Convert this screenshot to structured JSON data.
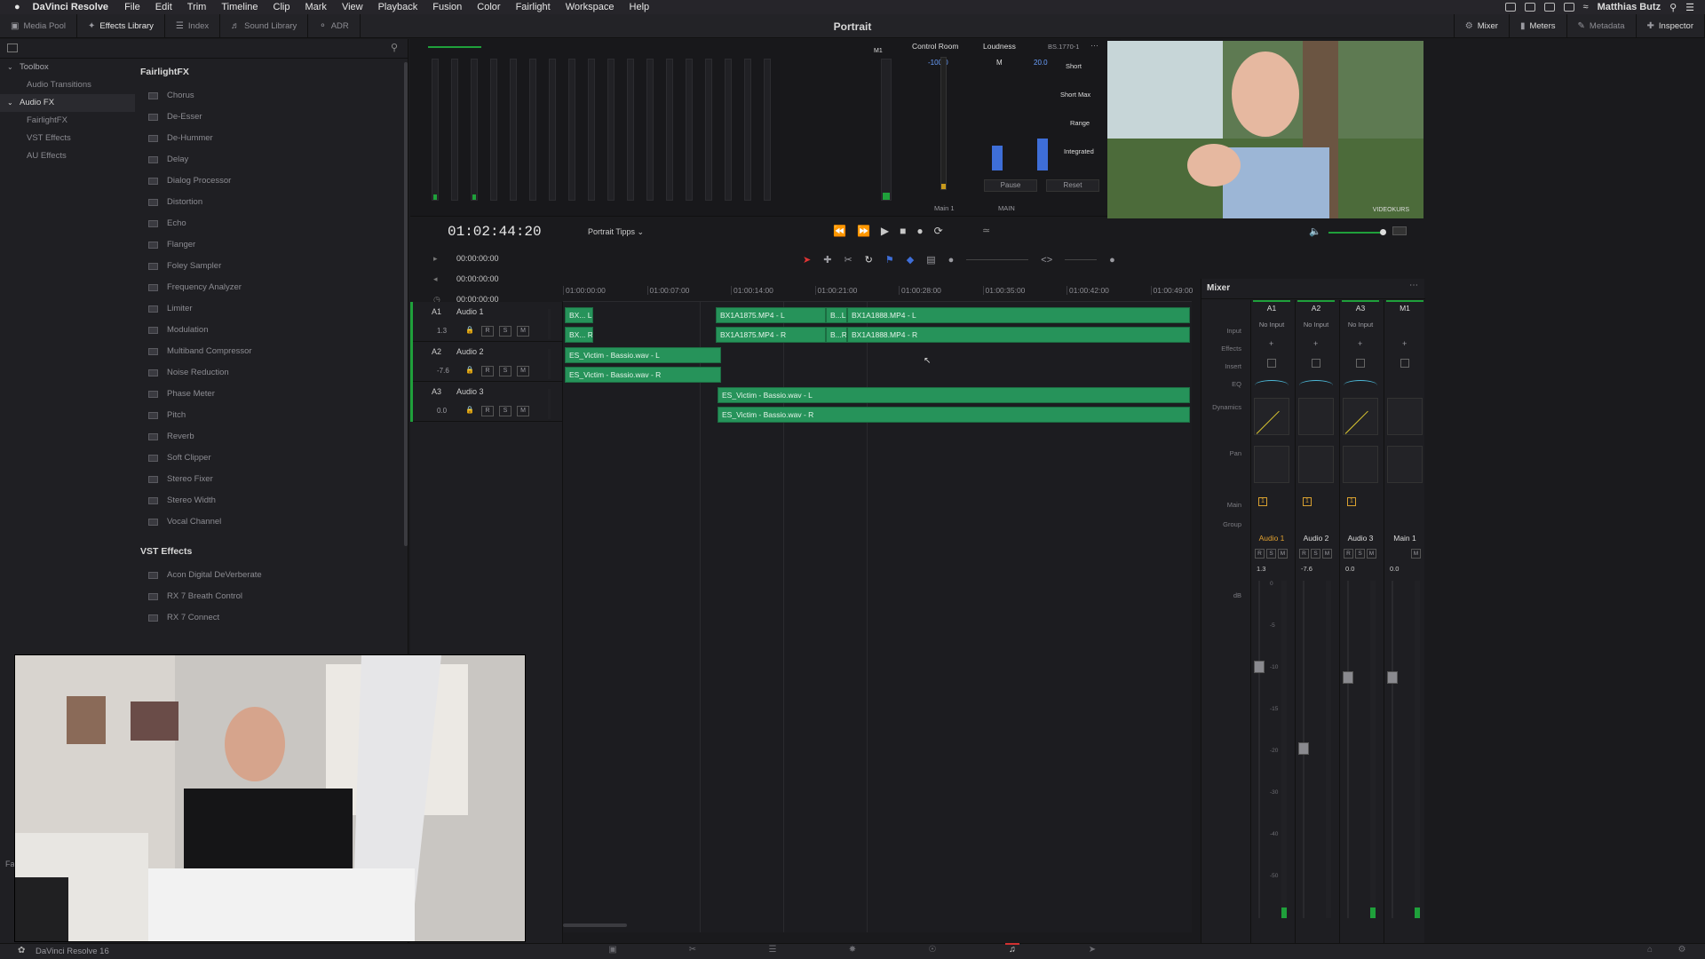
{
  "menubar": {
    "app": "DaVinci Resolve",
    "items": [
      "File",
      "Edit",
      "Trim",
      "Timeline",
      "Clip",
      "Mark",
      "View",
      "Playback",
      "Fusion",
      "Color",
      "Fairlight",
      "Workspace",
      "Help"
    ],
    "user": "Matthias Butz"
  },
  "toolbar": {
    "left": [
      "Media Pool",
      "Effects Library",
      "Index",
      "Sound Library",
      "ADR"
    ],
    "title": "Portrait",
    "right": [
      "Mixer",
      "Meters",
      "Metadata",
      "Inspector"
    ]
  },
  "toolbox": {
    "items": [
      {
        "label": "Toolbox",
        "cat": true
      },
      {
        "label": "Audio Transitions"
      },
      {
        "label": "Audio FX",
        "cat": true,
        "sel": true
      },
      {
        "label": "FairlightFX"
      },
      {
        "label": "VST Effects"
      },
      {
        "label": "AU Effects"
      }
    ]
  },
  "fx": {
    "section1": "FairlightFX",
    "list1": [
      "Chorus",
      "De-Esser",
      "De-Hummer",
      "Delay",
      "Dialog Processor",
      "Distortion",
      "Echo",
      "Flanger",
      "Foley Sampler",
      "Frequency Analyzer",
      "Limiter",
      "Modulation",
      "Multiband Compressor",
      "Noise Reduction",
      "Phase Meter",
      "Pitch",
      "Reverb",
      "Soft Clipper",
      "Stereo Fixer",
      "Stereo Width",
      "Vocal Channel"
    ],
    "section2": "VST Effects",
    "list2": [
      "Acon Digital DeVerberate",
      "RX 7 Breath Control",
      "RX 7 Connect"
    ]
  },
  "meters": {
    "control_room": "Control Room",
    "loudness": "Loudness",
    "standard": "BS.1770-1",
    "m1": "M1",
    "m": "M",
    "val1": "-100.0",
    "val2": "20.0",
    "labels": [
      "Short",
      "Short Max",
      "Range",
      "Integrated"
    ],
    "pause": "Pause",
    "reset": "Reset",
    "main": "Main 1",
    "main2": "MAIN"
  },
  "transport": {
    "timecode": "01:02:44:20",
    "timeline": "Portrait Tipps",
    "tc_rows": [
      "00:00:00:00",
      "00:00:00:00",
      "00:00:00:00"
    ]
  },
  "ruler": [
    "01:00:00:00",
    "01:00:07:00",
    "01:00:14:00",
    "01:00:21:00",
    "01:00:28:00",
    "01:00:35:00",
    "01:00:42:00",
    "01:00:49:00"
  ],
  "tracks": [
    {
      "id": "A1",
      "name": "Audio 1",
      "vol": "1.3"
    },
    {
      "id": "A2",
      "name": "Audio 2",
      "vol": "-7.6"
    },
    {
      "id": "A3",
      "name": "Audio 3",
      "vol": "0.0"
    }
  ],
  "clips": [
    "BX... L",
    "BX... R",
    "BX1A1875.MP4 - L",
    "BX1A1875.MP4 - R",
    "B...L",
    "B...R",
    "BX1A1888.MP4 - L",
    "BX1A1888.MP4 - R",
    "ES_Victim - Bassio.wav - L",
    "ES_Victim - Bassio.wav - R",
    "ES_Victim - Bassio.wav - L",
    "ES_Victim - Bassio.wav - R"
  ],
  "mixer": {
    "title": "Mixer",
    "channels": [
      "A1",
      "A2",
      "A3",
      "M1"
    ],
    "input": "No Input",
    "rows": [
      "Input",
      "Effects",
      "Insert",
      "EQ",
      "Dynamics",
      "Pan",
      "Main",
      "Group",
      "dB"
    ],
    "names": [
      "Audio 1",
      "Audio 2",
      "Audio 3",
      "Main 1"
    ],
    "vols": [
      "1.3",
      "-7.6",
      "0.0",
      "0.0"
    ],
    "bsm": [
      "R",
      "S",
      "M"
    ],
    "scale": [
      "0",
      "-5",
      "-10",
      "-15",
      "-20",
      "-30",
      "-40",
      "-50"
    ]
  },
  "footer": {
    "app": "DaVinci Resolve 16",
    "left_cut": "Fa"
  },
  "viewer": {
    "watermark": "VIDEOKURS"
  }
}
